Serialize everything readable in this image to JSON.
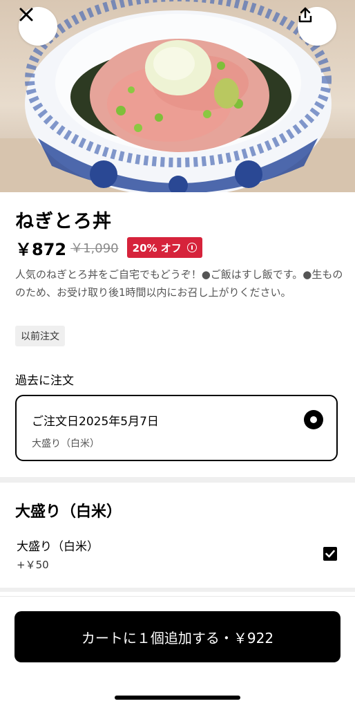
{
  "product": {
    "name": "ねぎとろ丼",
    "price": "￥872",
    "original_price": "￥1,090",
    "discount_label": "20% オフ",
    "description": "人気のねぎとろ丼をご自宅でもどうぞ！●ご飯はすし飯です。●生もののため、お受け取り後1時間以内にお召し上がりください。",
    "tag": "以前注文"
  },
  "past_orders": {
    "label": "過去に注文",
    "items": [
      {
        "date": "ご注文日2025年5月7日",
        "detail": "大盛り（白米）",
        "selected": true
      }
    ]
  },
  "options": {
    "title": "大盛り（白米）",
    "items": [
      {
        "name": "大盛り（白米）",
        "price": "+￥50",
        "checked": true
      }
    ]
  },
  "cart_button": {
    "label": "カートに１個追加する・￥922"
  },
  "icons": {
    "close": "close-icon",
    "share": "share-icon",
    "info": "info-icon",
    "radio": "radio-selected-icon",
    "check": "checkmark-icon"
  },
  "colors": {
    "discount_badge": "#d6233b",
    "primary": "#000000"
  }
}
